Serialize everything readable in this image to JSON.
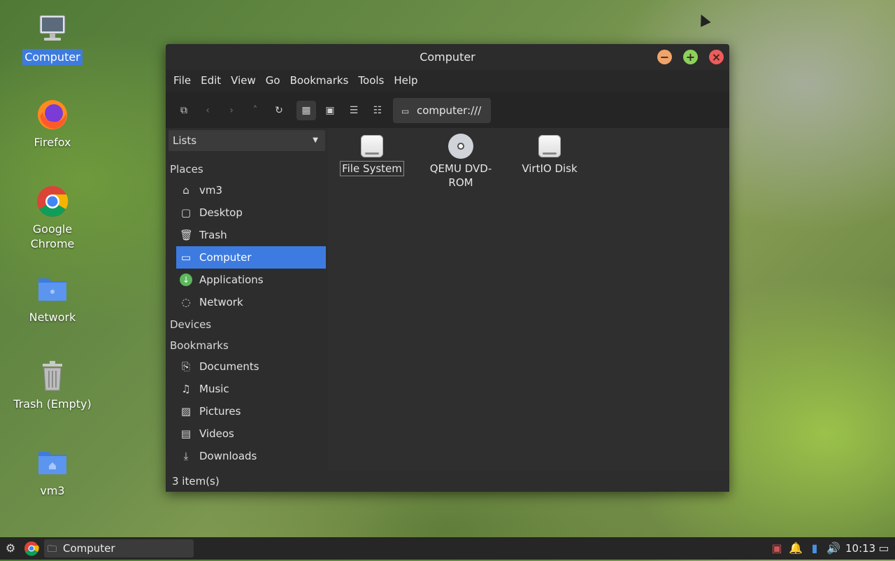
{
  "desktop": {
    "icons": [
      {
        "label": "Computer"
      },
      {
        "label": "Firefox"
      },
      {
        "label": "Google Chrome"
      },
      {
        "label": "Network"
      },
      {
        "label": "Trash (Empty)"
      },
      {
        "label": "vm3"
      }
    ]
  },
  "window": {
    "title": "Computer",
    "buttons": {
      "minimize": "−",
      "maximize": "+",
      "close": "×"
    }
  },
  "menu": [
    "File",
    "Edit",
    "View",
    "Go",
    "Bookmarks",
    "Tools",
    "Help"
  ],
  "toolbar": {
    "address": "computer:///"
  },
  "sidebar": {
    "combo": "Lists",
    "places_title": "Places",
    "places": [
      {
        "label": "vm3",
        "icon": "home-icon"
      },
      {
        "label": "Desktop",
        "icon": "desktop-icon"
      },
      {
        "label": "Trash",
        "icon": "trash-icon"
      },
      {
        "label": "Computer",
        "icon": "computer-icon"
      },
      {
        "label": "Applications",
        "icon": "applications-icon"
      },
      {
        "label": "Network",
        "icon": "network-icon"
      }
    ],
    "devices_title": "Devices",
    "bookmarks_title": "Bookmarks",
    "bookmarks": [
      {
        "label": "Documents",
        "icon": "documents-icon"
      },
      {
        "label": "Music",
        "icon": "music-icon"
      },
      {
        "label": "Pictures",
        "icon": "pictures-icon"
      },
      {
        "label": "Videos",
        "icon": "videos-icon"
      },
      {
        "label": "Downloads",
        "icon": "downloads-icon"
      }
    ]
  },
  "content": {
    "items": [
      {
        "label": "File System",
        "icon": "drive-icon"
      },
      {
        "label": "QEMU DVD-ROM",
        "icon": "disc-icon"
      },
      {
        "label": "VirtIO Disk",
        "icon": "drive-icon"
      }
    ]
  },
  "status": "3 item(s)",
  "taskbar": {
    "task": "Computer",
    "clock": "10:13"
  }
}
